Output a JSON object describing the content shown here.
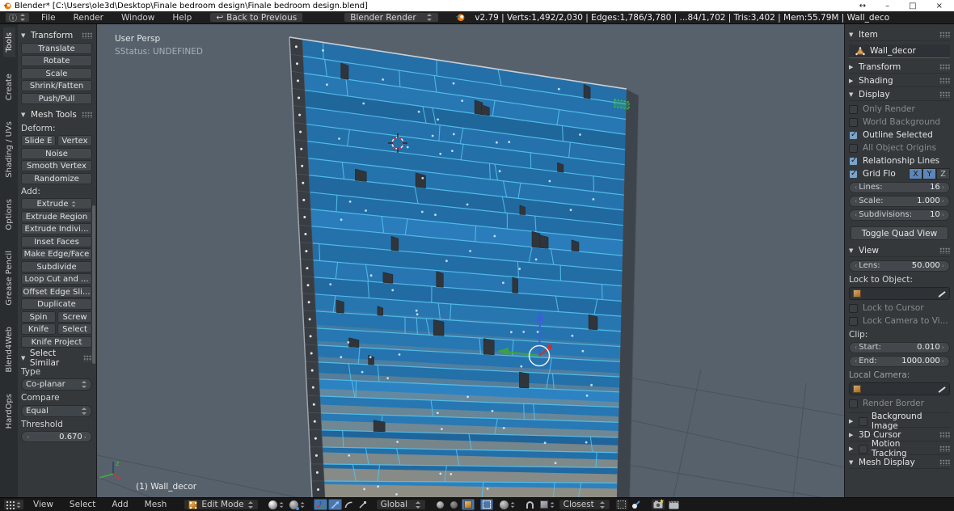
{
  "window": {
    "title": "Blender* [C:\\Users\\ole3d\\Desktop\\Finale bedroom design\\Finale bedroom design.blend]"
  },
  "topbar": {
    "menus": [
      "File",
      "Render",
      "Window",
      "Help"
    ],
    "back_button": "Back to Previous",
    "engine": "Blender Render",
    "stats": "v2.79 | Verts:1,492/2,030 | Edges:1,786/3,780 | ...84/1,702 | Tris:3,402 | Mem:55.79M | Wall_deco"
  },
  "tool_shelf": {
    "tabs": [
      "Tools",
      "Create",
      "Shading / UVs",
      "Options",
      "Grease Pencil",
      "Blend4Web",
      "HardOps"
    ],
    "transform": {
      "title": "Transform",
      "buttons": [
        "Translate",
        "Rotate",
        "Scale",
        "Shrink/Fatten",
        "Push/Pull"
      ]
    },
    "mesh_tools": {
      "title": "Mesh Tools",
      "deform_label": "Deform:",
      "slide_edge": "Slide E",
      "slide_vertex": "Vertex",
      "noise": "Noise",
      "smooth_vertex": "Smooth Vertex",
      "randomize": "Randomize",
      "add_label": "Add:",
      "extrude": "Extrude",
      "buttons": [
        "Extrude Region",
        "Extrude Indivi...",
        "Inset Faces",
        "Make Edge/Face",
        "Subdivide",
        "Loop Cut and ...",
        "Offset Edge Sli...",
        "Duplicate"
      ],
      "spin": "Spin",
      "screw": "Screw",
      "knife": "Knife",
      "select": "Select",
      "knife_project": "Knife Project"
    },
    "select_similar": {
      "title": "Select Similar",
      "type_label": "Type",
      "type_value": "Co-planar",
      "compare_label": "Compare",
      "compare_value": "Equal",
      "threshold_label": "Threshold",
      "threshold_value": "0.670"
    }
  },
  "viewport": {
    "view_label": "User Persp",
    "status_label": "SStatus: UNDEFINED",
    "object_label": "(1) Wall_decor",
    "axis_z_label": "z",
    "colors": {
      "bg": "#57616c",
      "grid": "#49525c",
      "edge": "#54c3f0",
      "plank_dark": "#1b5c8f",
      "plank_light": "#2e85c4",
      "side": "#3e444b",
      "block": "#2f353b",
      "cap": "#383d44",
      "bevel": "#8e8e85",
      "dot": "#d9eefb",
      "sel_green": "#3ad140",
      "cursor_red": "#c63a44",
      "giz_blue": "#3a5fd6",
      "giz_green": "#3da23d",
      "giz_red": "#c03636",
      "axis_red": "#a03a42",
      "top_edge": "#c9ced3"
    }
  },
  "props": {
    "item": {
      "title": "Item",
      "name": "Wall_decor"
    },
    "transform_title": "Transform",
    "shading_title": "Shading",
    "display": {
      "title": "Display",
      "checks": [
        {
          "label": "Only Render",
          "checked": false,
          "dim": true
        },
        {
          "label": "World Background",
          "checked": false,
          "dim": true
        },
        {
          "label": "Outline Selected",
          "checked": true,
          "dim": false
        },
        {
          "label": "All Object Origins",
          "checked": false,
          "dim": true
        },
        {
          "label": "Relationship Lines",
          "checked": true,
          "dim": false
        }
      ],
      "grid_label": "Grid Flo",
      "grid_checked": true,
      "axes": [
        {
          "label": "X",
          "active": true
        },
        {
          "label": "Y",
          "active": true
        },
        {
          "label": "Z",
          "active": false
        }
      ],
      "fields": [
        {
          "label": "Lines:",
          "value": "16"
        },
        {
          "label": "Scale:",
          "value": "1.000"
        },
        {
          "label": "Subdivisions:",
          "value": "10"
        }
      ],
      "quad_button": "Toggle Quad View"
    },
    "view": {
      "title": "View",
      "lens_label": "Lens:",
      "lens_value": "50.000",
      "lock_obj_label": "Lock to Object:",
      "lock_cursor": "Lock to Cursor",
      "lock_camera": "Lock Camera to Vi...",
      "clip_label": "Clip:",
      "start_label": "Start:",
      "start_value": "0.010",
      "end_label": "End:",
      "end_value": "1000.000",
      "local_cam_label": "Local Camera:",
      "render_border": "Render Border"
    },
    "collapsed": {
      "background_image": "Background Image",
      "cursor_3d": "3D Cursor",
      "motion_tracking": "Motion Tracking",
      "mesh_display": "Mesh Display"
    }
  },
  "bottom_bar": {
    "menus": [
      "View",
      "Select",
      "Add",
      "Mesh"
    ],
    "mode": "Edit Mode",
    "orientation": "Global",
    "snap_target": "Closest"
  }
}
